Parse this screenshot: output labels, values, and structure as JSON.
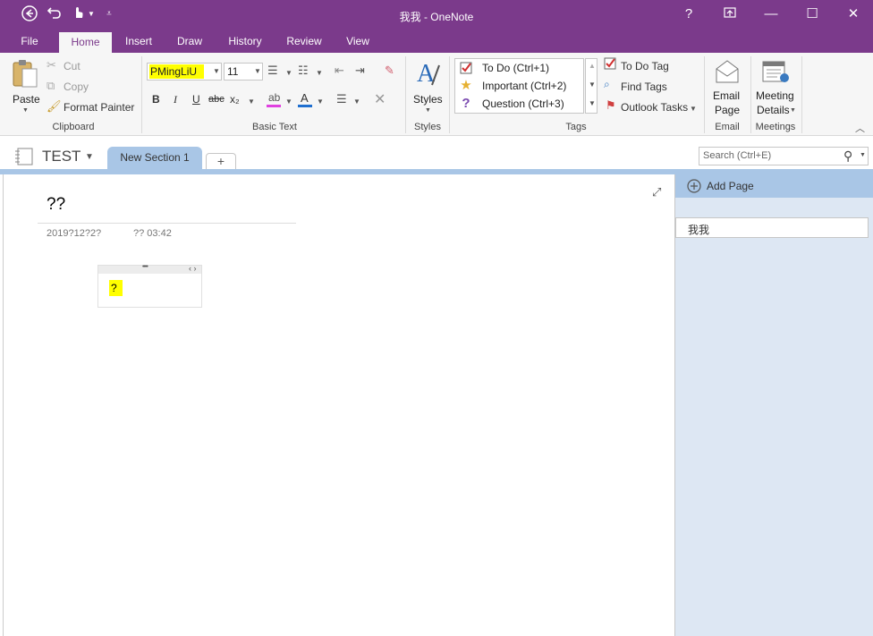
{
  "window": {
    "title": "我我 - OneNote"
  },
  "quick_access": {
    "back_icon": "back-circle-icon",
    "undo_icon": "undo-icon",
    "touch_icon": "touch-mode-icon",
    "customize_icon": "customize-icon"
  },
  "window_controls": {
    "help": "?",
    "restore_icon": "ribbon-display-icon",
    "minimize": "—",
    "maximize": "☐",
    "close": "✕"
  },
  "tabs": [
    "File",
    "Home",
    "Insert",
    "Draw",
    "History",
    "Review",
    "View"
  ],
  "active_tab": "Home",
  "ribbon": {
    "clipboard": {
      "paste": "Paste",
      "cut": "Cut",
      "copy": "Copy",
      "format_painter": "Format Painter",
      "label": "Clipboard"
    },
    "basic_text": {
      "font_name": "PMingLiU",
      "font_size": "11",
      "bold": "B",
      "italic": "I",
      "underline": "U",
      "strike": "abc",
      "subscript": "x₂",
      "label": "Basic Text"
    },
    "styles": {
      "button": "Styles",
      "label": "Styles"
    },
    "tags": {
      "items": [
        {
          "label": "To Do (Ctrl+1)",
          "icon": "checkbox-icon"
        },
        {
          "label": "Important (Ctrl+2)",
          "icon": "star-icon"
        },
        {
          "label": "Question (Ctrl+3)",
          "icon": "question-icon"
        }
      ],
      "todo_tag": "To Do Tag",
      "find_tags": "Find Tags",
      "outlook_tasks": "Outlook Tasks",
      "label": "Tags"
    },
    "email": {
      "button_line1": "Email",
      "button_line2": "Page",
      "label": "Email"
    },
    "meetings": {
      "button_line1": "Meeting",
      "button_line2": "Details",
      "label": "Meetings"
    }
  },
  "notebook": {
    "name": "TEST",
    "section": "New Section 1",
    "add_section": "+"
  },
  "search": {
    "placeholder": "Search (Ctrl+E)"
  },
  "page": {
    "title": "??",
    "date": "2019?12?2?",
    "time": "?? 03:42",
    "note_text": "?",
    "note_handle_dots": "••••",
    "note_arrows": "‹ ›"
  },
  "page_list": {
    "add_page": "Add Page",
    "pages": [
      "我我"
    ]
  },
  "colors": {
    "brand": "#7b3a8b",
    "section_blue": "#a9c6e6",
    "highlight": "#ffff00",
    "pane_bg": "#dde7f3"
  }
}
